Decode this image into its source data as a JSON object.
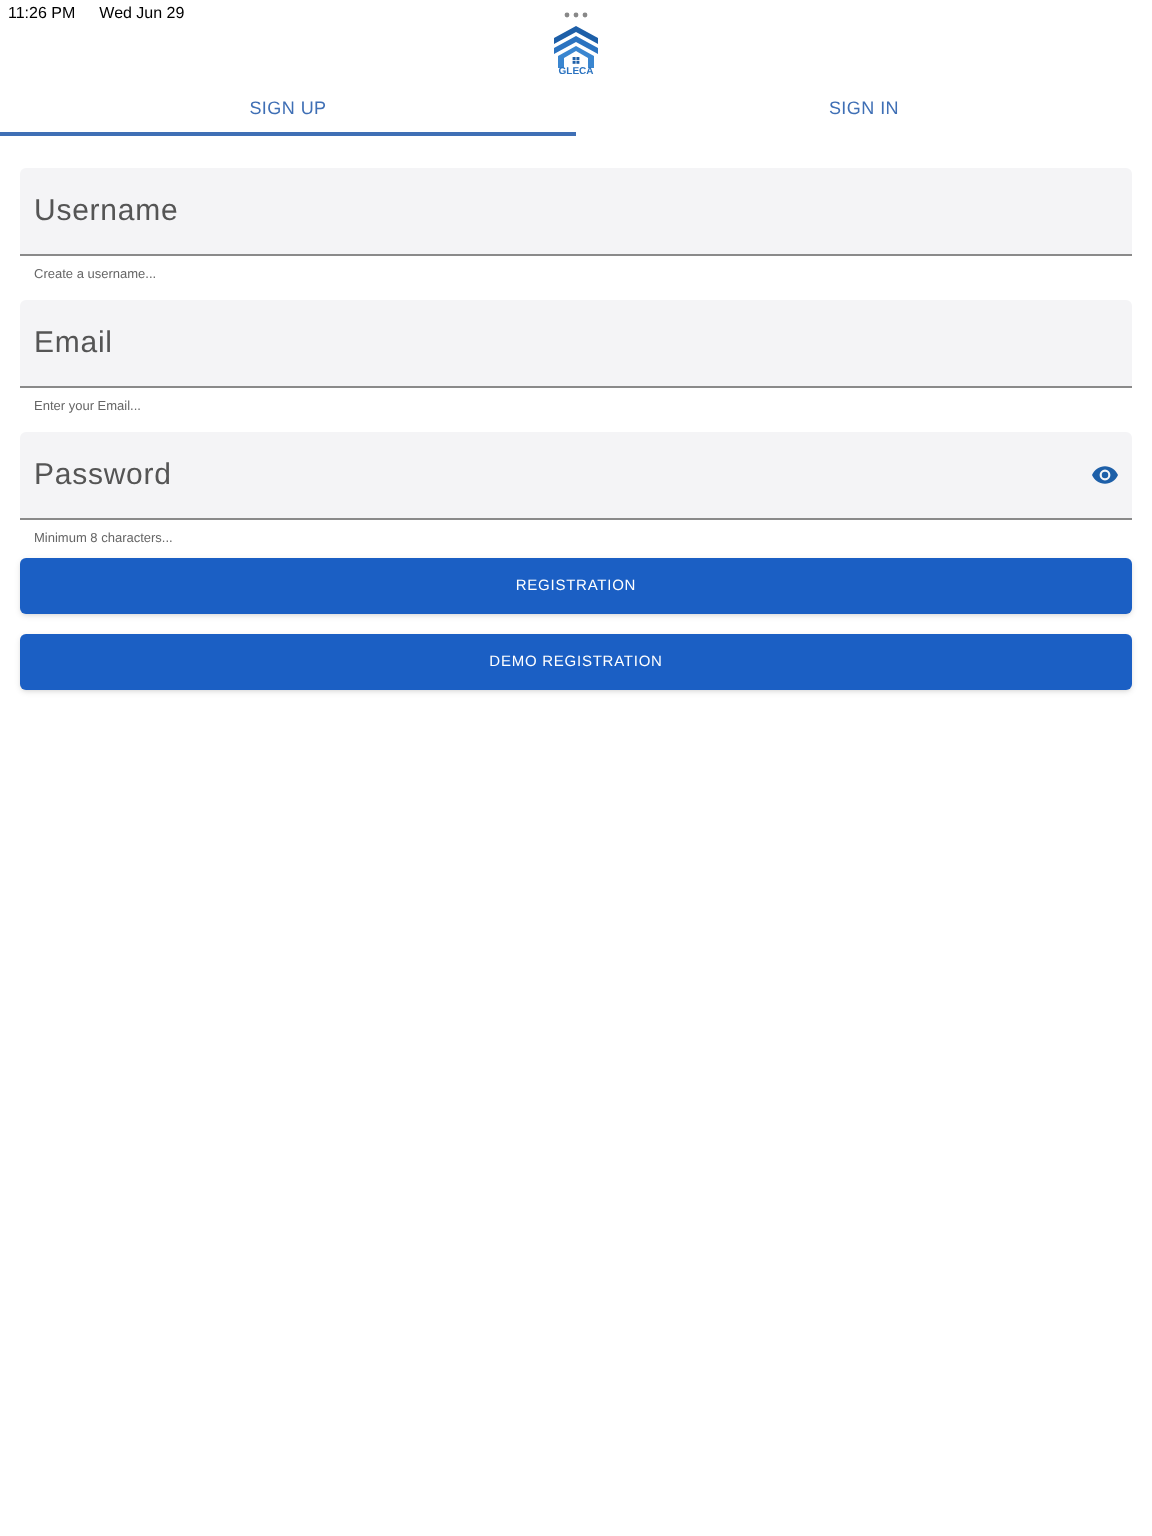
{
  "status_bar": {
    "time": "11:26 PM",
    "date": "Wed Jun 29"
  },
  "logo": {
    "text": "GLECA"
  },
  "tabs": [
    {
      "label": "SIGN UP",
      "selected": true
    },
    {
      "label": "SIGN IN",
      "selected": false
    }
  ],
  "fields": [
    {
      "placeholder": "Username",
      "helper": "Create a username...",
      "kind": "text"
    },
    {
      "placeholder": "Email",
      "helper": "Enter your Email...",
      "kind": "text"
    },
    {
      "placeholder": "Password",
      "helper": "Minimum 8 characters...",
      "kind": "password"
    }
  ],
  "buttons": [
    "REGISTRATION",
    "DEMO REGISTRATION"
  ]
}
